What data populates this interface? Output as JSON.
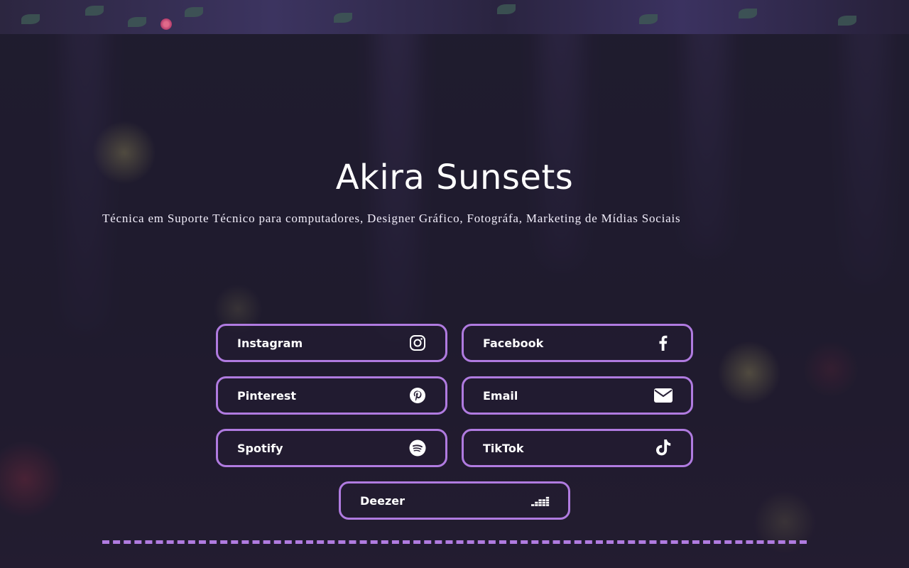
{
  "profile": {
    "name": "Akira Sunsets",
    "bio": "Técnica em Suporte Técnico para computadores, Designer Gráfico, Fotográfa, Marketing de Mídias Sociais"
  },
  "links": [
    {
      "label": "Instagram",
      "icon": "instagram-icon"
    },
    {
      "label": "Facebook",
      "icon": "facebook-icon"
    },
    {
      "label": "Pinterest",
      "icon": "pinterest-icon"
    },
    {
      "label": "Email",
      "icon": "envelope-icon"
    },
    {
      "label": "Spotify",
      "icon": "spotify-icon"
    },
    {
      "label": "TikTok",
      "icon": "tiktok-icon"
    },
    {
      "label": "Deezer",
      "icon": "deezer-icon"
    }
  ],
  "colors": {
    "accent": "#b07be0",
    "background": "#1f1b2e",
    "text": "#ffffff"
  }
}
